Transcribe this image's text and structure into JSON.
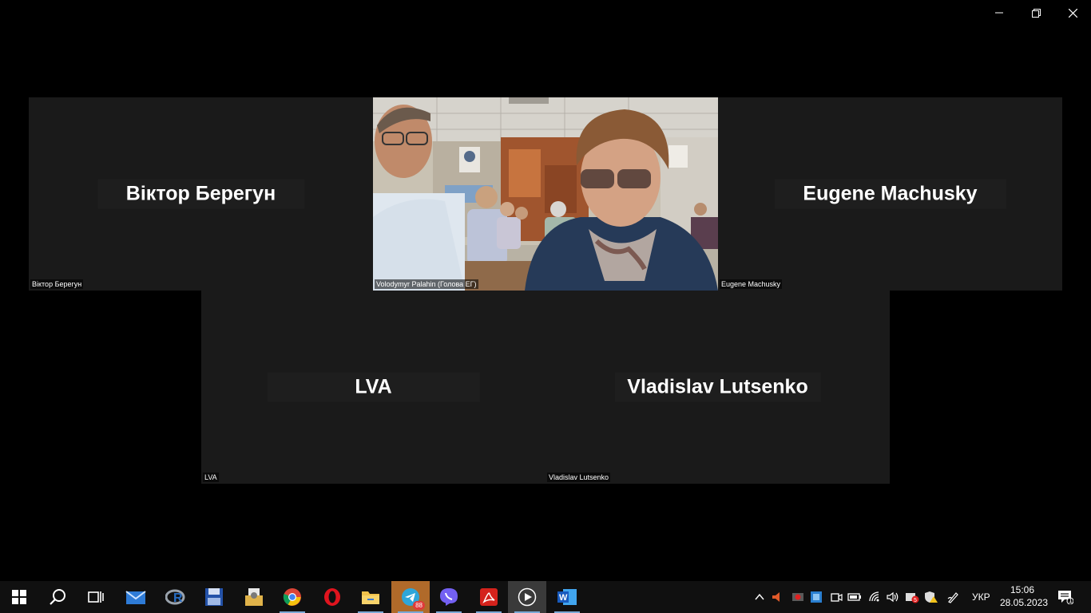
{
  "window": {
    "controls": {
      "minimize": "minimize-icon",
      "restore": "restore-icon",
      "close": "close-icon"
    }
  },
  "participants": [
    {
      "display_name": "Віктор Берегун",
      "label": "Віктор Берегун"
    },
    {
      "display_name": "",
      "label": "Volodymyr Palahin (Голова ЕГ)"
    },
    {
      "display_name": "Eugene Machusky",
      "label": "Eugene Machusky"
    },
    {
      "display_name": "LVA",
      "label": "LVA"
    },
    {
      "display_name": "Vladislav Lutsenko",
      "label": "Vladislav Lutsenko"
    }
  ],
  "taskbar": {
    "apps": [
      {
        "icon": "windows-start-icon"
      },
      {
        "icon": "search-icon"
      },
      {
        "icon": "task-view-icon"
      },
      {
        "icon": "mail-icon"
      },
      {
        "icon": "r-studio-icon"
      },
      {
        "icon": "save-disk-icon"
      },
      {
        "icon": "file-manager-icon"
      },
      {
        "icon": "chrome-icon"
      },
      {
        "icon": "opera-icon"
      },
      {
        "icon": "folder-icon"
      },
      {
        "icon": "telegram-icon",
        "badge": "88"
      },
      {
        "icon": "viber-icon"
      },
      {
        "icon": "acrobat-icon"
      },
      {
        "icon": "media-player-icon"
      },
      {
        "icon": "word-icon"
      }
    ],
    "tray": {
      "language": "УКР",
      "time": "15:06",
      "date": "28.05.2023",
      "notifications_count": "1"
    }
  },
  "colors": {
    "background": "#000000",
    "tile": "#1a1a1a",
    "taskbar": "#101010",
    "active_task": "#3a3a3a",
    "telegram_highlight": "#b06a2a"
  }
}
